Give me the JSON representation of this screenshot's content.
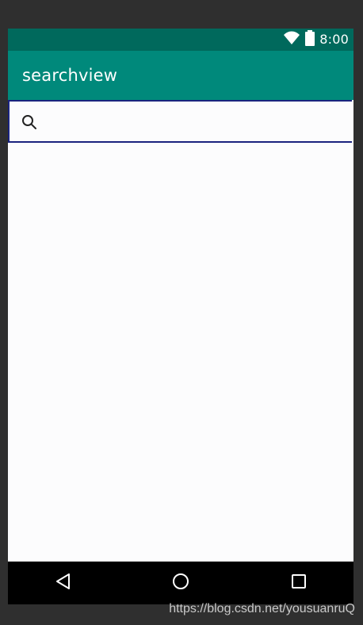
{
  "status_bar": {
    "time": "8:00",
    "icons": [
      "wifi-icon",
      "battery-icon"
    ]
  },
  "app_bar": {
    "title": "searchview"
  },
  "search": {
    "value": "",
    "placeholder": "",
    "icon": "search-icon"
  },
  "navigation": {
    "buttons": [
      "back-icon",
      "home-icon",
      "recents-icon"
    ]
  },
  "watermark": {
    "text": "https://blog.csdn.net/yousuanruQ"
  },
  "colors": {
    "status_bar": "#00695c",
    "app_bar": "#00897b",
    "search_border": "#1a237e",
    "content_background": "#fcfcfd",
    "navigation_bar": "#000000"
  }
}
